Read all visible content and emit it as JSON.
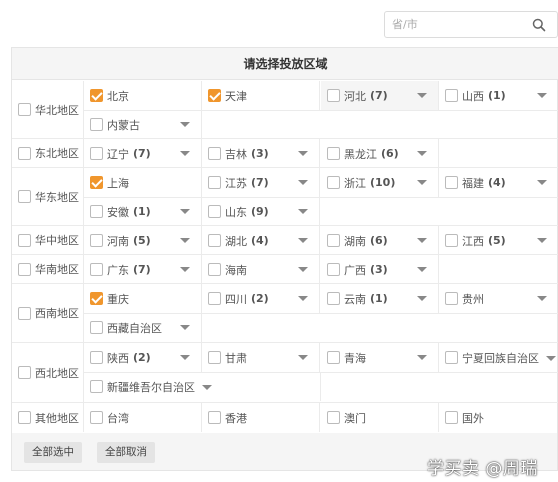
{
  "search": {
    "placeholder": "省/市"
  },
  "header": {
    "title": "请选择投放区域"
  },
  "buttons": {
    "select_all": "全部选中",
    "deselect_all": "全部取消"
  },
  "watermark": "学买卖 @周瑞",
  "colors": {
    "accent": "#f0962d",
    "header_bg": "#f5f5f5"
  },
  "regions": [
    {
      "label": "华北地区",
      "checked": false,
      "provinces": [
        {
          "name": "北京",
          "count": "",
          "checked": true,
          "dropdown": false
        },
        {
          "name": "天津",
          "count": "",
          "checked": true,
          "dropdown": false
        },
        {
          "name": "河北",
          "count": "(7)",
          "checked": false,
          "dropdown": true,
          "open": true
        },
        {
          "name": "山西",
          "count": "(1)",
          "checked": false,
          "dropdown": true
        },
        {
          "name": "内蒙古",
          "count": "",
          "checked": false,
          "dropdown": true
        }
      ]
    },
    {
      "label": "东北地区",
      "checked": false,
      "provinces": [
        {
          "name": "辽宁",
          "count": "(7)",
          "checked": false,
          "dropdown": true
        },
        {
          "name": "吉林",
          "count": "(3)",
          "checked": false,
          "dropdown": true
        },
        {
          "name": "黑龙江",
          "count": "(6)",
          "checked": false,
          "dropdown": true
        }
      ]
    },
    {
      "label": "华东地区",
      "checked": false,
      "provinces": [
        {
          "name": "上海",
          "count": "",
          "checked": true,
          "dropdown": false
        },
        {
          "name": "江苏",
          "count": "(7)",
          "checked": false,
          "dropdown": true
        },
        {
          "name": "浙江",
          "count": "(10)",
          "checked": false,
          "dropdown": true
        },
        {
          "name": "福建",
          "count": "(4)",
          "checked": false,
          "dropdown": true
        },
        {
          "name": "安徽",
          "count": "(1)",
          "checked": false,
          "dropdown": true
        },
        {
          "name": "山东",
          "count": "(9)",
          "checked": false,
          "dropdown": true
        }
      ]
    },
    {
      "label": "华中地区",
      "checked": false,
      "provinces": [
        {
          "name": "河南",
          "count": "(5)",
          "checked": false,
          "dropdown": true
        },
        {
          "name": "湖北",
          "count": "(4)",
          "checked": false,
          "dropdown": true
        },
        {
          "name": "湖南",
          "count": "(6)",
          "checked": false,
          "dropdown": true
        },
        {
          "name": "江西",
          "count": "(5)",
          "checked": false,
          "dropdown": true
        }
      ]
    },
    {
      "label": "华南地区",
      "checked": false,
      "provinces": [
        {
          "name": "广东",
          "count": "(7)",
          "checked": false,
          "dropdown": true
        },
        {
          "name": "海南",
          "count": "",
          "checked": false,
          "dropdown": true
        },
        {
          "name": "广西",
          "count": "(3)",
          "checked": false,
          "dropdown": true
        }
      ]
    },
    {
      "label": "西南地区",
      "checked": false,
      "provinces": [
        {
          "name": "重庆",
          "count": "",
          "checked": true,
          "dropdown": false
        },
        {
          "name": "四川",
          "count": "(2)",
          "checked": false,
          "dropdown": true
        },
        {
          "name": "云南",
          "count": "(1)",
          "checked": false,
          "dropdown": true
        },
        {
          "name": "贵州",
          "count": "",
          "checked": false,
          "dropdown": true
        },
        {
          "name": "西藏自治区",
          "count": "",
          "checked": false,
          "dropdown": true
        }
      ]
    },
    {
      "label": "西北地区",
      "checked": false,
      "provinces": [
        {
          "name": "陕西",
          "count": "(2)",
          "checked": false,
          "dropdown": true
        },
        {
          "name": "甘肃",
          "count": "",
          "checked": false,
          "dropdown": true
        },
        {
          "name": "青海",
          "count": "",
          "checked": false,
          "dropdown": true
        },
        {
          "name": "宁夏回族自治区",
          "count": "",
          "checked": false,
          "dropdown": true
        },
        {
          "name": "新疆维吾尔自治区",
          "count": "",
          "checked": false,
          "dropdown": true
        }
      ]
    },
    {
      "label": "其他地区",
      "checked": false,
      "provinces": [
        {
          "name": "台湾",
          "count": "",
          "checked": false,
          "dropdown": false
        },
        {
          "name": "香港",
          "count": "",
          "checked": false,
          "dropdown": false
        },
        {
          "name": "澳门",
          "count": "",
          "checked": false,
          "dropdown": false
        },
        {
          "name": "国外",
          "count": "",
          "checked": false,
          "dropdown": false
        }
      ]
    }
  ]
}
